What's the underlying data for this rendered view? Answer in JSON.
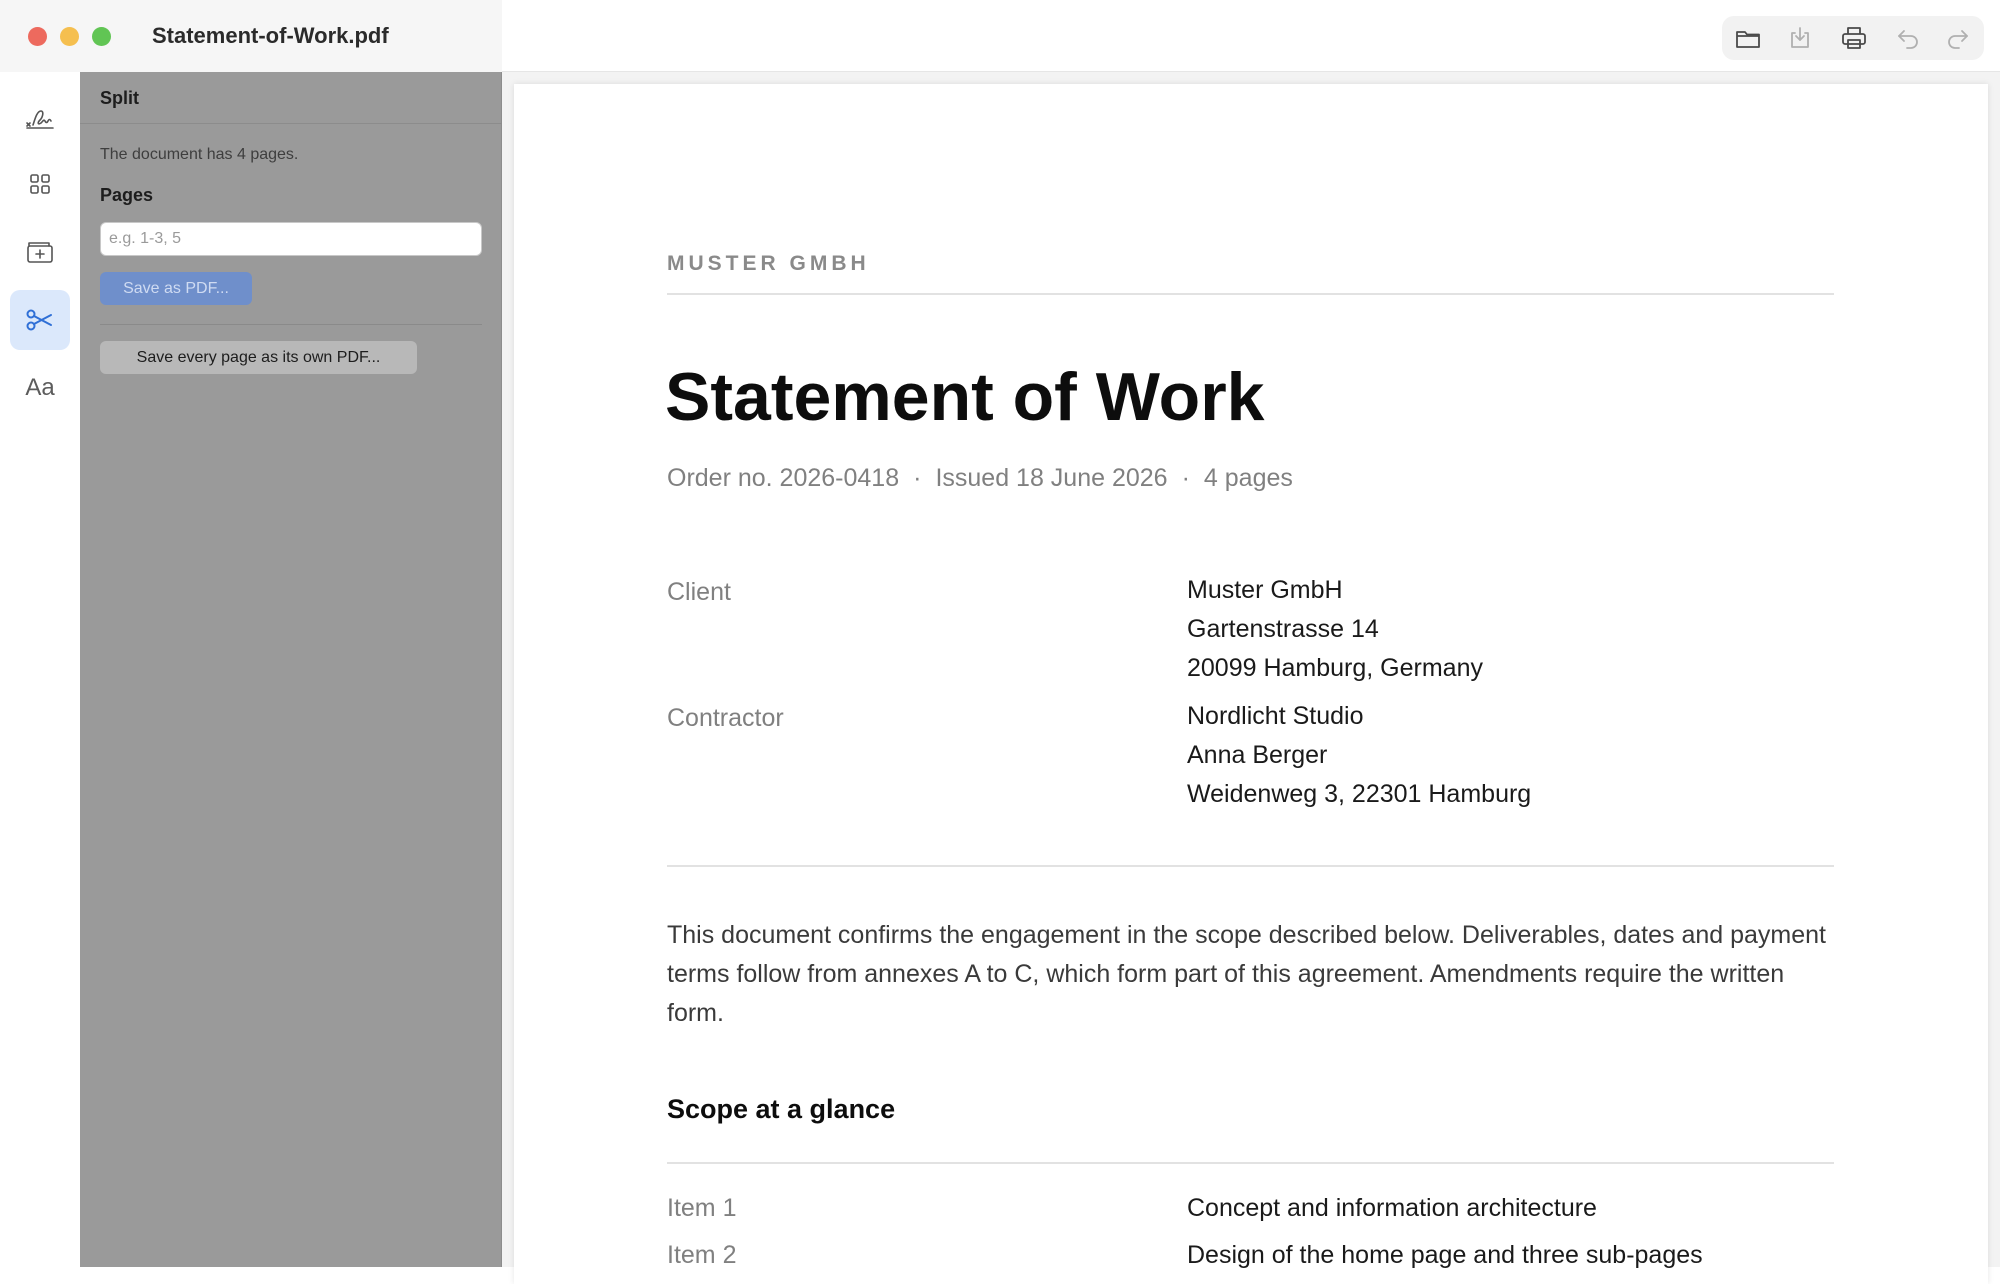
{
  "window": {
    "title": "Statement-of-Work.pdf"
  },
  "toolbar": {
    "icons": [
      "folder-icon",
      "download-icon",
      "print-icon",
      "undo-icon",
      "redo-icon"
    ]
  },
  "rail": {
    "items": [
      "signature-icon",
      "grid-icon",
      "add-page-icon",
      "scissors-icon",
      "text-format-icon"
    ],
    "active": "scissors-icon",
    "text_format_label": "Aa"
  },
  "panel": {
    "title": "Split",
    "info": "The document has 4 pages.",
    "pages_label": "Pages",
    "pages_placeholder": "e.g. 1-3, 5",
    "pages_value": "",
    "save_label": "Save as PDF...",
    "save_every_label": "Save every page as its own PDF..."
  },
  "document": {
    "company": "MUSTER GMBH",
    "title": "Statement of Work",
    "order_no": "Order no. 2026-0418",
    "issued": "Issued 18 June 2026",
    "pages": "4 pages",
    "separator": "·",
    "client_label": "Client",
    "client_lines": [
      "Muster GmbH",
      "Gartenstrasse 14",
      "20099 Hamburg, Germany"
    ],
    "contractor_label": "Contractor",
    "contractor_lines": [
      "Nordlicht Studio",
      "Anna Berger",
      "Weidenweg 3, 22301 Hamburg"
    ],
    "paragraph": "This document confirms the engagement in the scope described below. Deliverables, dates and payment terms follow from annexes A to C, which form part of this agreement. Amendments require the written form.",
    "scope_title": "Scope at a glance",
    "scope_items": [
      {
        "label": "Item 1",
        "value": "Concept and information architecture"
      },
      {
        "label": "Item 2",
        "value": "Design of the home page and three sub-pages"
      }
    ]
  },
  "colors": {
    "accent": "#2f6fd6",
    "panel_bg": "#9a9a9a",
    "save_button": "#6f8fcb"
  }
}
